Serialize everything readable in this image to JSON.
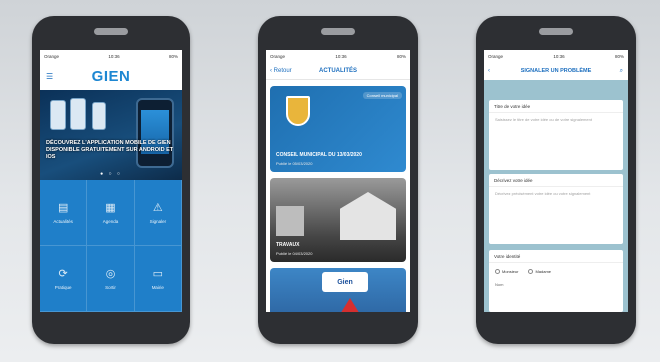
{
  "phone1": {
    "status": {
      "left": "Orange",
      "center": "10:36",
      "right": "80%"
    },
    "brand": "GIEN",
    "banner_text": "DÉCOUVREZ L'APPLICATION MOBILE DE GIEN DISPONIBLE GRATUITEMENT SUR ANDROID ET IOS",
    "tiles": [
      {
        "icon": "▤",
        "label": "Actualités"
      },
      {
        "icon": "▦",
        "label": "Agenda"
      },
      {
        "icon": "⚠",
        "label": "Signaler"
      },
      {
        "icon": "⟳",
        "label": "Pratique"
      },
      {
        "icon": "◎",
        "label": "Sortir"
      },
      {
        "icon": "▭",
        "label": "Mairie"
      }
    ]
  },
  "phone2": {
    "status": {
      "left": "Orange",
      "center": "10:36",
      "right": "80%"
    },
    "back_label": "‹ Retour",
    "title": "ACTUALITÉS",
    "cards": [
      {
        "pill": "Conseil municipal",
        "title": "CONSEIL MUNICIPAL DU 13/03/2020",
        "sub": "Publié le 05/03/2020"
      },
      {
        "title": "TRAVAUX",
        "sub": "Publié le 04/03/2020"
      },
      {
        "sign": "Gien"
      }
    ]
  },
  "phone3": {
    "status": {
      "left": "Orange",
      "center": "10:36",
      "right": "80%"
    },
    "back_label": "‹",
    "title": "SIGNALER UN PROBLÈME",
    "search_icon": "⌕",
    "panels": [
      {
        "label": "Titre de votre idée",
        "placeholder": "Saisissez le titre de votre idée ou de votre signalement"
      },
      {
        "label": "Décrivez votre idée",
        "placeholder": "Décrivez précisément votre idée ou votre signalement"
      },
      {
        "label": "Votre identité",
        "options": [
          "Monsieur",
          "Madame"
        ],
        "extra": "Nom"
      }
    ]
  }
}
